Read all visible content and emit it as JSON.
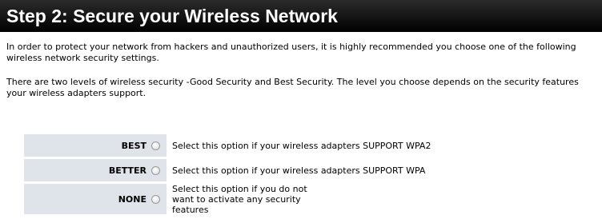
{
  "title": "Step 2: Secure your Wireless Network",
  "paragraph1": "In order to protect your network from hackers and unauthorized users, it is highly recommended you choose one of the following wireless network security settings.",
  "paragraph2": "There are two levels of wireless security -Good Security and Best Security. The level you choose depends on the security features your wireless adapters support.",
  "options": [
    {
      "label": "BEST",
      "text": "Select this option if your wireless adapters SUPPORT WPA2"
    },
    {
      "label": "BETTER",
      "text": "Select this option if your wireless adapters SUPPORT WPA"
    },
    {
      "label": "NONE",
      "text": "Select this option if you do not want to activate any security features"
    }
  ],
  "colors": {
    "title_bg": "#000000",
    "label_cell_bg": "#dfe3ea"
  }
}
